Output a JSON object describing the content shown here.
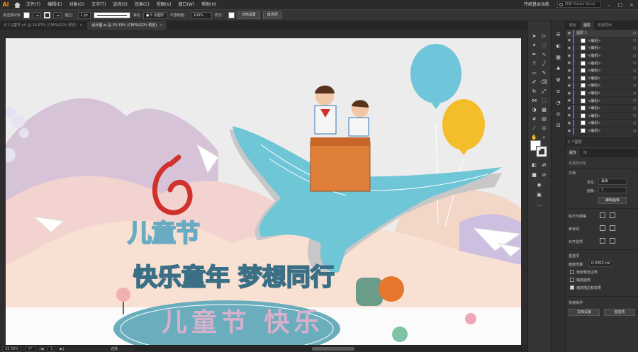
{
  "app": {
    "logo": "Ai",
    "home_icon": "home-icon"
  },
  "menubar": {
    "items": [
      "文件(F)",
      "编辑(E)",
      "对象(O)",
      "文字(T)",
      "选择(S)",
      "效果(C)",
      "视图(V)",
      "窗口(W)",
      "帮助(H)"
    ],
    "workspace": "传统基本功能",
    "search_placeholder": "搜索 Adobe Stock"
  },
  "controlbar": {
    "selection": "未选择对象",
    "stroke_label": "描边：",
    "stroke_weight": "1 pt",
    "stroke_style": "等比",
    "brush": "5 点圆形",
    "opacity_label": "不透明度：",
    "opacity_value": "100%",
    "style_label": "样式：",
    "doc_settings": "文档设置",
    "preferences": "首选项"
  },
  "tabs": [
    {
      "label": "6.1儿童节.ai* @ 16.67% (CMYK/GPU 预览)",
      "active": false
    },
    {
      "label": "设计图.ai @ 33.33% (CMYK/GPU 预览)",
      "active": true
    }
  ],
  "artwork": {
    "title_1": "儿童节",
    "title_2": "快乐童年 梦想同行",
    "ground_text": "儿童节 快乐"
  },
  "statusbar": {
    "zoom": "33.33%",
    "rotation": "0°",
    "page": "1",
    "tool": "选择"
  },
  "layers_panel": {
    "tabs": [
      "颜色",
      "图层",
      "资源导出"
    ],
    "active_tab": "图层",
    "layer_name": "图层 1",
    "rows": [
      "<编组>",
      "<编组>",
      "<编组>",
      "<编组>",
      "<编组>",
      "<编组>",
      "<编组>",
      "<编组>",
      "<编组>",
      "<编组>",
      "<编组>",
      "<编组>",
      "<编组>"
    ],
    "footer": "1 个图层"
  },
  "properties_panel": {
    "tabs": [
      "属性",
      "库"
    ],
    "no_selection": "未选择对象",
    "document_section": "文档",
    "units_label": "单位：",
    "units_value": "毫米",
    "artboard_label": "画板：",
    "artboard_value": "1",
    "edit_artboard_button": "编辑画板",
    "ruler_grid_label": "标尺与网格",
    "guides_label": "参考线",
    "snap_label": "对齐选项",
    "prefs_section": "首选项",
    "key_increment_label": "键盘增量：",
    "key_increment_value": "0.0353 cm",
    "checkboxes": [
      {
        "label": "使用预览边界",
        "checked": false
      },
      {
        "label": "缩放圆角",
        "checked": false
      },
      {
        "label": "缩放描边和效果",
        "checked": true
      }
    ],
    "quick_actions_label": "快速操作",
    "doc_settings_button": "文档设置",
    "preferences_button": "首选项"
  },
  "colors": {
    "whale": "#6ec6d6",
    "balloon_blue": "#6fc5d9",
    "balloon_yellow": "#f4bd2a",
    "title_blue": "#6aabc4",
    "title_pink": "#d7b1cb",
    "logo_red": "#d0312d",
    "box": "#e07f3a"
  }
}
